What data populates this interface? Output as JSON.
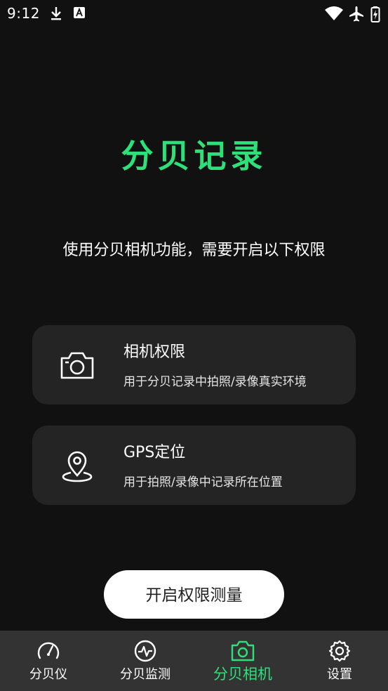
{
  "status_bar": {
    "time": "9:12",
    "icons": [
      "download-icon",
      "font-a-icon",
      "wifi-icon",
      "airplane-icon",
      "battery-charging-icon"
    ]
  },
  "header": {
    "title": "分贝记录",
    "subtitle": "使用分贝相机功能，需要开启以下权限"
  },
  "permissions": [
    {
      "icon": "camera-icon",
      "title": "相机权限",
      "desc": "用于分贝记录中拍照/录像真实环境"
    },
    {
      "icon": "location-pin-icon",
      "title": "GPS定位",
      "desc": "用于拍照/录像中记录所在位置"
    }
  ],
  "action_button": {
    "label": "开启权限测量"
  },
  "tabs": [
    {
      "icon": "speedometer-icon",
      "label": "分贝仪",
      "active": false
    },
    {
      "icon": "pulse-icon",
      "label": "分贝监测",
      "active": false
    },
    {
      "icon": "camera-icon",
      "label": "分贝相机",
      "active": true
    },
    {
      "icon": "gear-icon",
      "label": "设置",
      "active": false
    }
  ],
  "colors": {
    "accent": "#2ee07a",
    "background": "#111111",
    "card": "#242424",
    "tabbar": "#333333"
  }
}
